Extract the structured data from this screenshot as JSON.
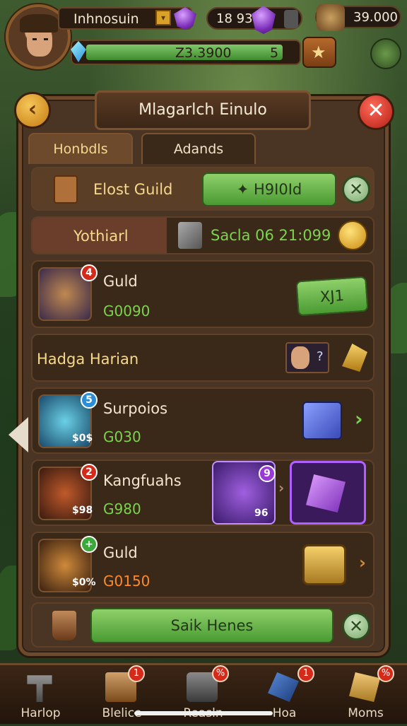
{
  "hud": {
    "player_name": "Inhnosuin",
    "rank_badge": "▾",
    "gems_pill": "18  93",
    "gold": "39.000",
    "xp_value": "Z3.3900",
    "level": "5 0"
  },
  "panel": {
    "title": "Mlagarlch Einulo",
    "back_glyph": "‹",
    "close_glyph": "✕",
    "tabs": [
      {
        "label": "Honbdls",
        "active": true
      },
      {
        "label": "Adands",
        "active": false
      }
    ]
  },
  "guild_bar": {
    "label": "Elost Guild",
    "button": "✦ H9I0Id",
    "dismiss": "✕"
  },
  "stats_row": {
    "label": "Yothiarl",
    "stats": "Sacla 06  21:099"
  },
  "items": [
    {
      "name": "Guld",
      "value": "G0090",
      "badge": "4",
      "button": "XJ1"
    },
    {
      "name": "Surpoios",
      "value": "G030",
      "price": "$0$",
      "badge": "5"
    },
    {
      "name": "Kangfuahs",
      "value": "G980",
      "price": "$98",
      "badge": "2",
      "reward_badge": "9",
      "reward_count": "96"
    },
    {
      "name": "Guld",
      "value": "G0150",
      "price": "$0%",
      "badge": "+"
    }
  ],
  "section": {
    "header": "Hadga Harian",
    "portrait_count": "?"
  },
  "footer": {
    "button": "Saik Henes",
    "dismiss": "✕"
  },
  "nav": [
    {
      "label": "Harlop",
      "badge": null
    },
    {
      "label": "Blelice",
      "badge": "1"
    },
    {
      "label": "Reasln",
      "badge": "%"
    },
    {
      "label": "Hoa",
      "badge": "1"
    },
    {
      "label": "Moms",
      "badge": "%"
    }
  ],
  "colors": {
    "panel_bg": "#4a3424",
    "accent_green": "#7ad44e",
    "accent_gold": "#f5d98f",
    "close_red": "#d42a1a"
  }
}
